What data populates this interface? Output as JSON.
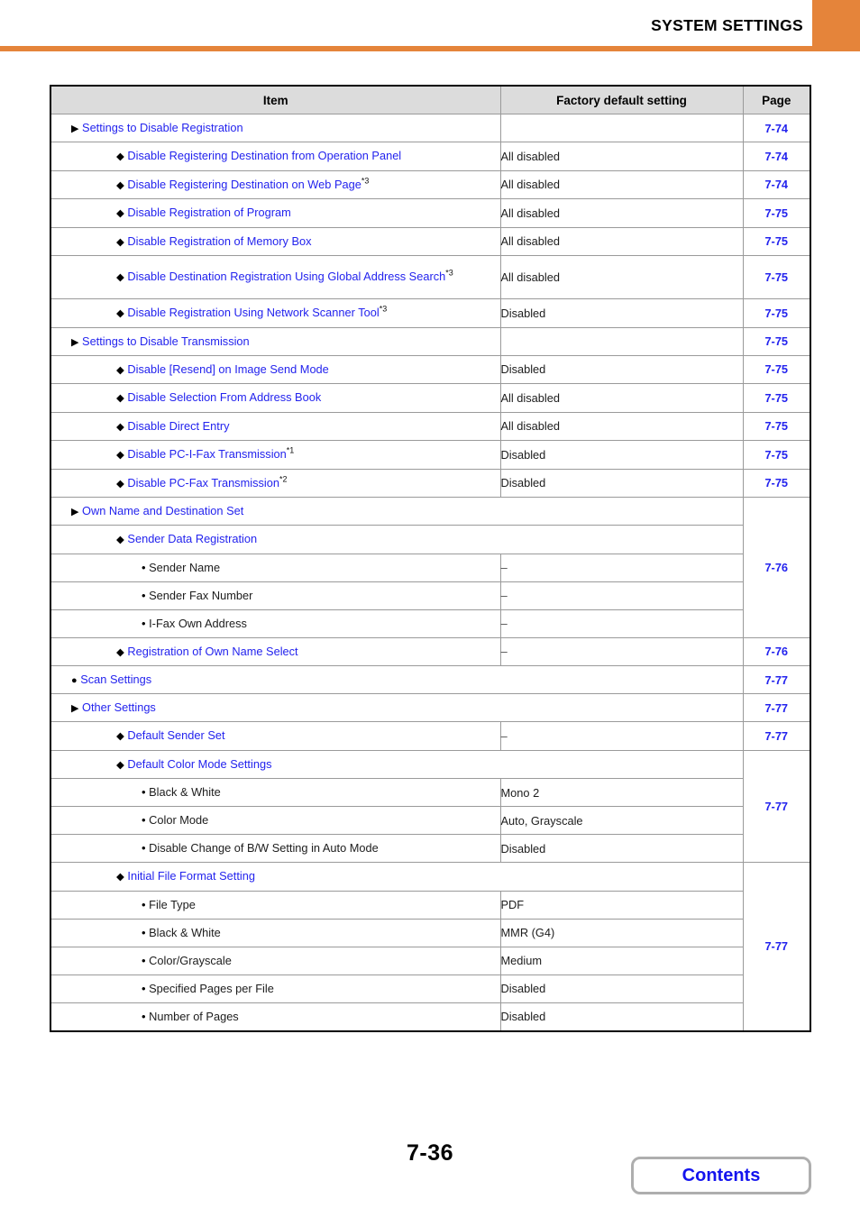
{
  "header": {
    "title": "SYSTEM SETTINGS",
    "accent_color": "#e5843a"
  },
  "table": {
    "columns": {
      "item": "Item",
      "factory": "Factory default setting",
      "page": "Page"
    },
    "link_color": "#2323ee",
    "rows": [
      {
        "level": 1,
        "bullet": "triangle",
        "label": "Settings to Disable Registration",
        "link": true,
        "factory": "",
        "page": "7-74"
      },
      {
        "level": 2,
        "bullet": "diamond",
        "label": "Disable Registering Destination from Operation Panel",
        "link": true,
        "factory": "All disabled",
        "page": "7-74"
      },
      {
        "level": 2,
        "bullet": "diamond",
        "label": "Disable Registering Destination on Web Page",
        "footnote": "*3",
        "link": true,
        "factory": "All disabled",
        "page": "7-74"
      },
      {
        "level": 2,
        "bullet": "diamond",
        "label": "Disable Registration of Program",
        "link": true,
        "factory": "All disabled",
        "page": "7-75"
      },
      {
        "level": 2,
        "bullet": "diamond",
        "label": "Disable Registration of Memory Box",
        "link": true,
        "factory": "All disabled",
        "page": "7-75"
      },
      {
        "level": 2,
        "bullet": "diamond",
        "label": "Disable Destination Registration Using Global Address Search",
        "footnote": "*3",
        "link": true,
        "factory": "All disabled",
        "page": "7-75",
        "tall": true
      },
      {
        "level": 2,
        "bullet": "diamond",
        "label": "Disable Registration Using Network Scanner Tool",
        "footnote": "*3",
        "link": true,
        "factory": "Disabled",
        "page": "7-75"
      },
      {
        "level": 1,
        "bullet": "triangle",
        "label": "Settings to Disable Transmission",
        "link": true,
        "factory": "",
        "page": "7-75"
      },
      {
        "level": 2,
        "bullet": "diamond",
        "label": "Disable [Resend] on Image Send Mode",
        "link": true,
        "factory": "Disabled",
        "page": "7-75"
      },
      {
        "level": 2,
        "bullet": "diamond",
        "label": "Disable Selection From Address Book",
        "link": true,
        "factory": "All disabled",
        "page": "7-75"
      },
      {
        "level": 2,
        "bullet": "diamond",
        "label": "Disable Direct Entry",
        "link": true,
        "factory": "All disabled",
        "page": "7-75"
      },
      {
        "level": 2,
        "bullet": "diamond",
        "label": "Disable PC-I-Fax Transmission",
        "footnote": "*1",
        "link": true,
        "factory": "Disabled",
        "page": "7-75"
      },
      {
        "level": 2,
        "bullet": "diamond",
        "label": "Disable PC-Fax Transmission",
        "footnote": "*2",
        "link": true,
        "factory": "Disabled",
        "page": "7-75"
      },
      {
        "level": 1,
        "bullet": "triangle",
        "label": "Own Name and Destination Set",
        "link": true,
        "span_item": true,
        "page": "7-76",
        "page_rowspan": 5
      },
      {
        "level": 2,
        "bullet": "diamond",
        "label": "Sender Data Registration",
        "link": true,
        "span_item": true,
        "page_merged": true
      },
      {
        "level": 3,
        "bullet": "dot",
        "label": "Sender Name",
        "link": false,
        "factory": "–",
        "page_merged": true
      },
      {
        "level": 3,
        "bullet": "dot",
        "label": "Sender Fax Number",
        "link": false,
        "factory": "–",
        "page_merged": true
      },
      {
        "level": 3,
        "bullet": "dot",
        "label": "I-Fax Own Address",
        "link": false,
        "factory": "–",
        "page_merged": true
      },
      {
        "level": 2,
        "bullet": "diamond",
        "label": "Registration of Own Name Select",
        "link": true,
        "factory": "–",
        "page": "7-76"
      },
      {
        "level": 0,
        "bullet": "circle",
        "label": "Scan Settings",
        "link": true,
        "span_item": true,
        "page": "7-77"
      },
      {
        "level": 1,
        "bullet": "triangle",
        "label": "Other Settings",
        "link": true,
        "span_item": true,
        "page": "7-77"
      },
      {
        "level": 2,
        "bullet": "diamond",
        "label": "Default Sender Set",
        "link": true,
        "factory": "–",
        "page": "7-77"
      },
      {
        "level": 2,
        "bullet": "diamond",
        "label": "Default Color Mode Settings",
        "link": true,
        "span_item": true,
        "page": "7-77",
        "page_rowspan": 4
      },
      {
        "level": 3,
        "bullet": "dot",
        "label": "Black & White",
        "link": false,
        "factory": "Mono 2",
        "page_merged": true
      },
      {
        "level": 3,
        "bullet": "dot",
        "label": "Color Mode",
        "link": false,
        "factory": "Auto, Grayscale",
        "page_merged": true
      },
      {
        "level": 3,
        "bullet": "dot",
        "label": "Disable Change of B/W Setting in Auto Mode",
        "link": false,
        "factory": "Disabled",
        "page_merged": true
      },
      {
        "level": 2,
        "bullet": "diamond",
        "label": "Initial File Format Setting",
        "link": true,
        "span_item": true,
        "page": "7-77",
        "page_rowspan": 6
      },
      {
        "level": 3,
        "bullet": "dot",
        "label": "File Type",
        "link": false,
        "factory": "PDF",
        "page_merged": true
      },
      {
        "level": 3,
        "bullet": "dot",
        "label": "Black & White",
        "link": false,
        "factory": "MMR (G4)",
        "page_merged": true
      },
      {
        "level": 3,
        "bullet": "dot",
        "label": "Color/Grayscale",
        "link": false,
        "factory": "Medium",
        "page_merged": true
      },
      {
        "level": 3,
        "bullet": "dot",
        "label": "Specified Pages per File",
        "link": false,
        "factory": "Disabled",
        "page_merged": true
      },
      {
        "level": 3,
        "bullet": "dot",
        "label": "Number of Pages",
        "link": false,
        "factory": "Disabled",
        "page_merged": true
      }
    ]
  },
  "footer": {
    "page_number": "7-36",
    "contents_label": "Contents"
  }
}
